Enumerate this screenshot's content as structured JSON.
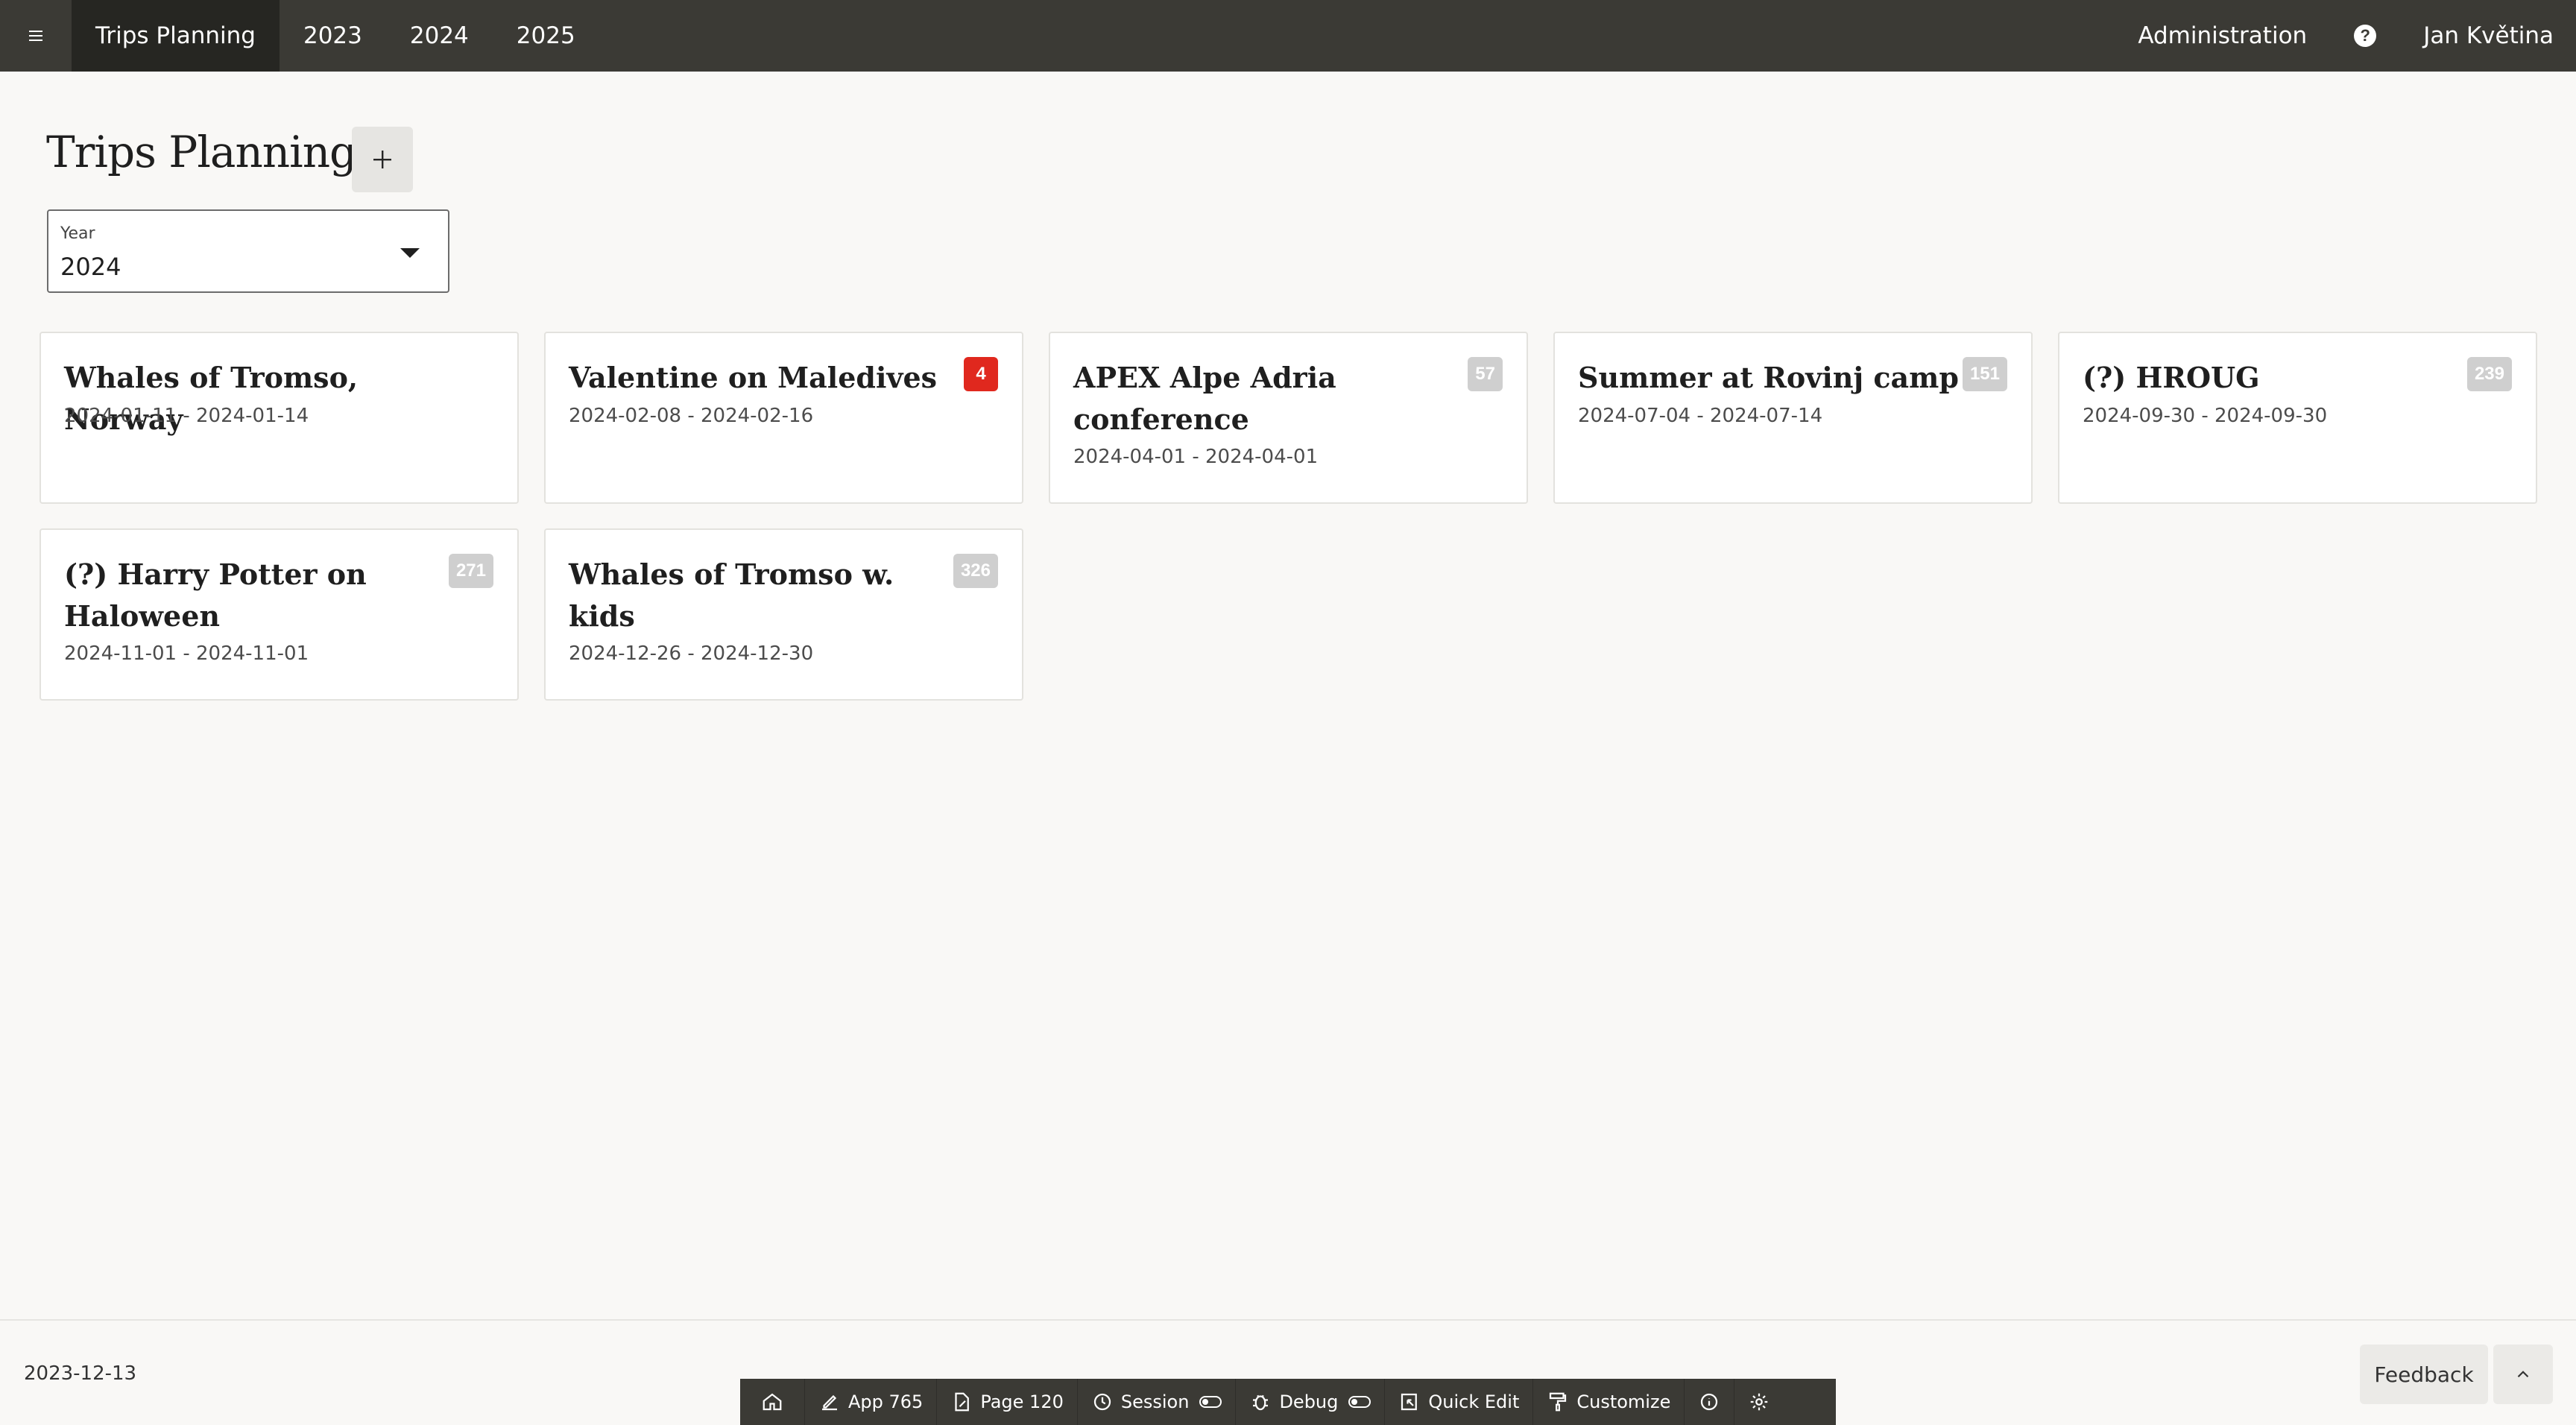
{
  "nav": {
    "items": [
      {
        "label": "Trips Planning",
        "active": true
      },
      {
        "label": "2023"
      },
      {
        "label": "2024"
      },
      {
        "label": "2025"
      }
    ],
    "admin_label": "Administration",
    "help_icon": "question-circle-icon",
    "user_name": "Jan Květina"
  },
  "page": {
    "title": "Trips Planning",
    "add_icon": "plus-icon"
  },
  "year_select": {
    "label": "Year",
    "value": "2024"
  },
  "cards": [
    {
      "title": "Whales of Tromso, Norway",
      "dates": "2024-01-11 - 2024-01-14",
      "badge": ""
    },
    {
      "title": "Valentine on Maledives",
      "dates": "2024-02-08 - 2024-02-16",
      "badge": "4",
      "badge_color": "#e0281e"
    },
    {
      "title": "APEX Alpe Adria conference",
      "dates": "2024-04-01 - 2024-04-01",
      "badge": "57"
    },
    {
      "title": "Summer at Rovinj camp",
      "dates": "2024-07-04 - 2024-07-14",
      "badge": "151"
    },
    {
      "title": "(?) HROUG",
      "dates": "2024-09-30 - 2024-09-30",
      "badge": "239"
    },
    {
      "title": "(?) Harry Potter on Haloween",
      "dates": "2024-11-01 - 2024-11-01",
      "badge": "271"
    },
    {
      "title": "Whales of Tromso w. kids",
      "dates": "2024-12-26 - 2024-12-30",
      "badge": "326"
    }
  ],
  "footer": {
    "date": "2023-12-13",
    "feedback_label": "Feedback",
    "scroll_top_icon": "chevron-up-icon"
  },
  "dev_toolbar": {
    "home_icon": "home-icon",
    "app_label": "App 765",
    "page_label": "Page 120",
    "session_label": "Session",
    "debug_label": "Debug",
    "quick_edit_label": "Quick Edit",
    "customize_label": "Customize",
    "info_icon": "info-icon",
    "settings_icon": "gear-icon"
  }
}
